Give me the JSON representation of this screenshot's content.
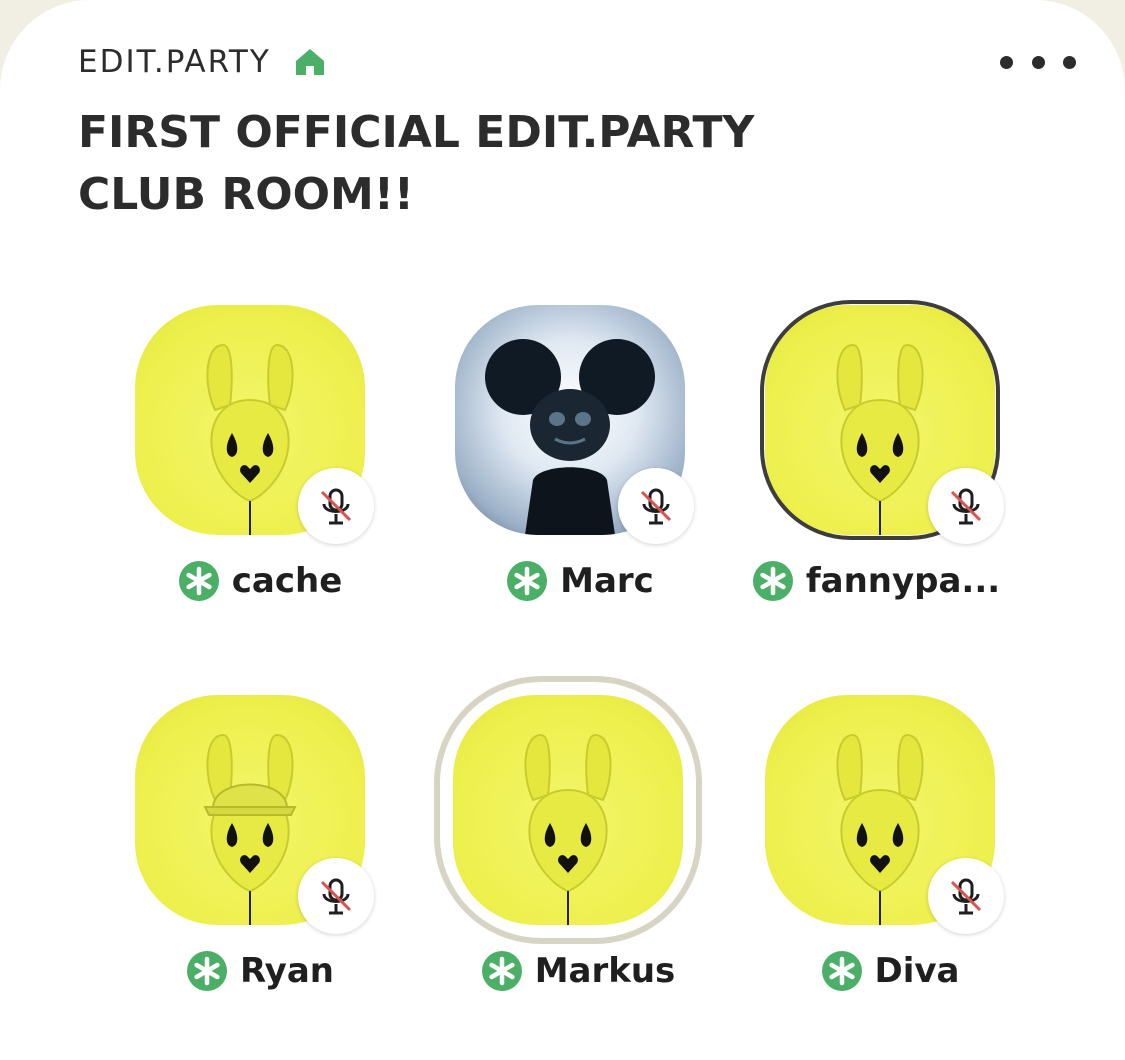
{
  "room": {
    "club_name": "EDIT.PARTY",
    "title_line1": "FIRST OFFICIAL EDIT.PARTY",
    "title_line2": "CLUB ROOM!!"
  },
  "speakers": [
    {
      "name": "cache",
      "avatar": "yellow-bunny",
      "muted": true,
      "moderator": true
    },
    {
      "name": "Marc",
      "avatar": "mouse-head-photo",
      "muted": true,
      "moderator": true
    },
    {
      "name": "fannypa...",
      "avatar": "yellow-bunny",
      "muted": true,
      "moderator": true
    },
    {
      "name": "Ryan",
      "avatar": "yellow-bunny-cap",
      "muted": true,
      "moderator": true
    },
    {
      "name": "Markus",
      "avatar": "yellow-bunny",
      "muted": false,
      "speaking": true,
      "moderator": true
    },
    {
      "name": "Diva",
      "avatar": "yellow-bunny",
      "muted": true,
      "moderator": true
    }
  ],
  "icons": {
    "home": "home-icon",
    "more": "more-options-icon",
    "muted": "muted-mic-icon",
    "moderator": "moderator-star-icon"
  },
  "colors": {
    "accent_green": "#4caf67",
    "avatar_yellow": "#eef04e",
    "mute_slash": "#d9534f",
    "text_dark": "#2c2c2c",
    "background": "#ffffff"
  }
}
